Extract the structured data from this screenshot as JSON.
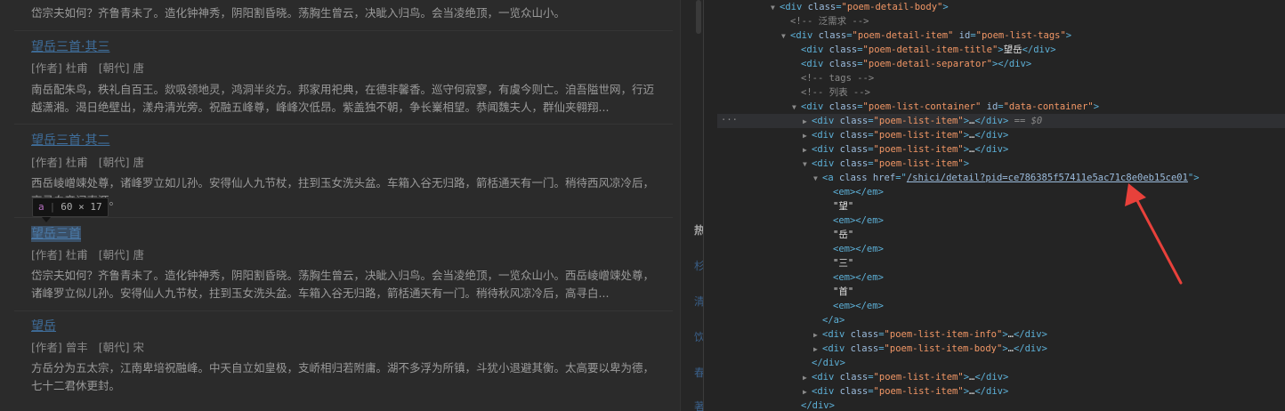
{
  "page": {
    "top_text": "岱宗夫如何？齐鲁青未了。造化钟神秀，阴阳割昏晓。荡胸生曾云，决眦入归鸟。会当凌绝顶，一览众山小。",
    "poems": [
      {
        "title": "望岳三首·其三",
        "author_label": "[作者] 杜甫",
        "dynasty_label": "[朝代] 唐",
        "body": "南岳配朱鸟，秩礼自百王。欻吸领地灵，鸿洞半炎方。邦家用祀典，在德非馨香。巡守何寂寥，有虞今则亡。洎吾隘世网，行迈越潇湘。渴日绝壁出，漾舟清光旁。祝融五峰尊，峰峰次低昂。紫盖独不朝，争长嶪相望。恭闻魏夫人，群仙夹翱翔..."
      },
      {
        "title": "望岳三首·其二",
        "author_label": "[作者] 杜甫",
        "dynasty_label": "[朝代] 唐",
        "body": "西岳崚嶒竦处尊，诸峰罗立如儿孙。安得仙人九节杖，拄到玉女洗头盆。车箱入谷无归路，箭栝通天有一门。稍待西风凉冷后，高寻白帝问真源。"
      },
      {
        "title": "望岳三首",
        "author_label": "[作者] 杜甫",
        "dynasty_label": "[朝代] 唐",
        "body": "岱宗夫如何？齐鲁青未了。造化钟神秀，阴阳割昏晓。荡胸生曾云，决眦入归鸟。会当凌绝顶，一览众山小。西岳崚嶒竦处尊，诸峰罗立似儿孙。安得仙人九节杖，拄到玉女洗头盆。车箱入谷无归路，箭栝通天有一门。稍待秋风凉冷后，高寻白..."
      },
      {
        "title": "望岳",
        "author_label": "[作者] 曾丰",
        "dynasty_label": "[朝代] 宋",
        "body": "方岳分为五太宗，江南卑培祝融峰。中天自立如皇极，支峤相归若附庸。湖不多浮为所镇，斗犹小退避其衡。太高要以卑为德，七十二君休更封。"
      }
    ],
    "tooltip": {
      "tag": "a",
      "size": "60 × 17"
    },
    "side_chars": [
      "热",
      "杉",
      "清",
      "饮",
      "春",
      "著"
    ]
  },
  "devtools": {
    "lines": [
      {
        "indent": 4,
        "tri": "▼",
        "parts": [
          [
            "t",
            "<div "
          ],
          [
            "a",
            "class"
          ],
          [
            "t",
            "="
          ],
          [
            "v",
            "\"poem-detail-body\""
          ],
          [
            "t",
            ">"
          ]
        ]
      },
      {
        "indent": 5,
        "tri": "",
        "parts": [
          [
            "c",
            "<!-- 泛需求 -->"
          ]
        ]
      },
      {
        "indent": 5,
        "tri": "▼",
        "parts": [
          [
            "t",
            "<div "
          ],
          [
            "a",
            "class"
          ],
          [
            "t",
            "="
          ],
          [
            "v",
            "\"poem-detail-item\""
          ],
          [
            "a",
            " id"
          ],
          [
            "t",
            "="
          ],
          [
            "v",
            "\"poem-list-tags\""
          ],
          [
            "t",
            ">"
          ]
        ]
      },
      {
        "indent": 6,
        "tri": "",
        "parts": [
          [
            "t",
            "<div "
          ],
          [
            "a",
            "class"
          ],
          [
            "t",
            "="
          ],
          [
            "v",
            "\"poem-detail-item-title\""
          ],
          [
            "t",
            ">"
          ],
          [
            "x",
            "望岳"
          ],
          [
            "t",
            "</div>"
          ]
        ]
      },
      {
        "indent": 6,
        "tri": "",
        "parts": [
          [
            "t",
            "<div "
          ],
          [
            "a",
            "class"
          ],
          [
            "t",
            "="
          ],
          [
            "v",
            "\"poem-detail-separator\""
          ],
          [
            "t",
            "></div>"
          ]
        ]
      },
      {
        "indent": 6,
        "tri": "",
        "parts": [
          [
            "c",
            "<!-- tags -->"
          ]
        ]
      },
      {
        "indent": 6,
        "tri": "",
        "parts": [
          [
            "c",
            "<!-- 列表 -->"
          ]
        ]
      },
      {
        "indent": 6,
        "tri": "▼",
        "parts": [
          [
            "t",
            "<div "
          ],
          [
            "a",
            "class"
          ],
          [
            "t",
            "="
          ],
          [
            "v",
            "\"poem-list-container\""
          ],
          [
            "a",
            " id"
          ],
          [
            "t",
            "="
          ],
          [
            "v",
            "\"data-container\""
          ],
          [
            "t",
            ">"
          ]
        ]
      },
      {
        "indent": 7,
        "tri": "▶",
        "selected": true,
        "parts": [
          [
            "t",
            "<div "
          ],
          [
            "a",
            "class"
          ],
          [
            "t",
            "="
          ],
          [
            "v",
            "\"poem-list-item\""
          ],
          [
            "t",
            ">"
          ],
          [
            "x",
            "…"
          ],
          [
            "t",
            "</div>"
          ],
          [
            "eq",
            " == $0"
          ]
        ]
      },
      {
        "indent": 7,
        "tri": "▶",
        "parts": [
          [
            "t",
            "<div "
          ],
          [
            "a",
            "class"
          ],
          [
            "t",
            "="
          ],
          [
            "v",
            "\"poem-list-item\""
          ],
          [
            "t",
            ">"
          ],
          [
            "x",
            "…"
          ],
          [
            "t",
            "</div>"
          ]
        ]
      },
      {
        "indent": 7,
        "tri": "▶",
        "parts": [
          [
            "t",
            "<div "
          ],
          [
            "a",
            "class"
          ],
          [
            "t",
            "="
          ],
          [
            "v",
            "\"poem-list-item\""
          ],
          [
            "t",
            ">"
          ],
          [
            "x",
            "…"
          ],
          [
            "t",
            "</div>"
          ]
        ]
      },
      {
        "indent": 7,
        "tri": "▼",
        "parts": [
          [
            "t",
            "<div "
          ],
          [
            "a",
            "class"
          ],
          [
            "t",
            "="
          ],
          [
            "v",
            "\"poem-list-item\""
          ],
          [
            "t",
            ">"
          ]
        ]
      },
      {
        "indent": 8,
        "tri": "▼",
        "parts": [
          [
            "t",
            "<a "
          ],
          [
            "a",
            "class href"
          ],
          [
            "t",
            "="
          ],
          [
            "t",
            "\""
          ],
          [
            "link",
            "/shici/detail?pid=ce786385f57411e5ac71c8e0eb15ce01"
          ],
          [
            "t",
            "\">"
          ]
        ]
      },
      {
        "indent": 9,
        "tri": "",
        "parts": [
          [
            "t",
            "<em></em>"
          ]
        ]
      },
      {
        "indent": 9,
        "tri": "",
        "parts": [
          [
            "x",
            "\"望\""
          ]
        ]
      },
      {
        "indent": 9,
        "tri": "",
        "parts": [
          [
            "t",
            "<em></em>"
          ]
        ]
      },
      {
        "indent": 9,
        "tri": "",
        "parts": [
          [
            "x",
            "\"岳\""
          ]
        ]
      },
      {
        "indent": 9,
        "tri": "",
        "parts": [
          [
            "t",
            "<em></em>"
          ]
        ]
      },
      {
        "indent": 9,
        "tri": "",
        "parts": [
          [
            "x",
            "\"三\""
          ]
        ]
      },
      {
        "indent": 9,
        "tri": "",
        "parts": [
          [
            "t",
            "<em></em>"
          ]
        ]
      },
      {
        "indent": 9,
        "tri": "",
        "parts": [
          [
            "x",
            "\"首\""
          ]
        ]
      },
      {
        "indent": 9,
        "tri": "",
        "parts": [
          [
            "t",
            "<em></em>"
          ]
        ]
      },
      {
        "indent": 8,
        "tri": "",
        "parts": [
          [
            "t",
            "</a>"
          ]
        ]
      },
      {
        "indent": 8,
        "tri": "▶",
        "parts": [
          [
            "t",
            "<div "
          ],
          [
            "a",
            "class"
          ],
          [
            "t",
            "="
          ],
          [
            "v",
            "\"poem-list-item-info\""
          ],
          [
            "t",
            ">"
          ],
          [
            "x",
            "…"
          ],
          [
            "t",
            "</div>"
          ]
        ]
      },
      {
        "indent": 8,
        "tri": "▶",
        "parts": [
          [
            "t",
            "<div "
          ],
          [
            "a",
            "class"
          ],
          [
            "t",
            "="
          ],
          [
            "v",
            "\"poem-list-item-body\""
          ],
          [
            "t",
            ">"
          ],
          [
            "x",
            "…"
          ],
          [
            "t",
            "</div>"
          ]
        ]
      },
      {
        "indent": 7,
        "tri": "",
        "parts": [
          [
            "t",
            "</div>"
          ]
        ]
      },
      {
        "indent": 7,
        "tri": "▶",
        "parts": [
          [
            "t",
            "<div "
          ],
          [
            "a",
            "class"
          ],
          [
            "t",
            "="
          ],
          [
            "v",
            "\"poem-list-item\""
          ],
          [
            "t",
            ">"
          ],
          [
            "x",
            "…"
          ],
          [
            "t",
            "</div>"
          ]
        ]
      },
      {
        "indent": 7,
        "tri": "▶",
        "parts": [
          [
            "t",
            "<div "
          ],
          [
            "a",
            "class"
          ],
          [
            "t",
            "="
          ],
          [
            "v",
            "\"poem-list-item\""
          ],
          [
            "t",
            ">"
          ],
          [
            "x",
            "…"
          ],
          [
            "t",
            "</div>"
          ]
        ]
      },
      {
        "indent": 6,
        "tri": "",
        "parts": [
          [
            "t",
            "</div>"
          ]
        ]
      }
    ],
    "ellipsis": "...",
    "arrow_color": "#e8413b"
  }
}
